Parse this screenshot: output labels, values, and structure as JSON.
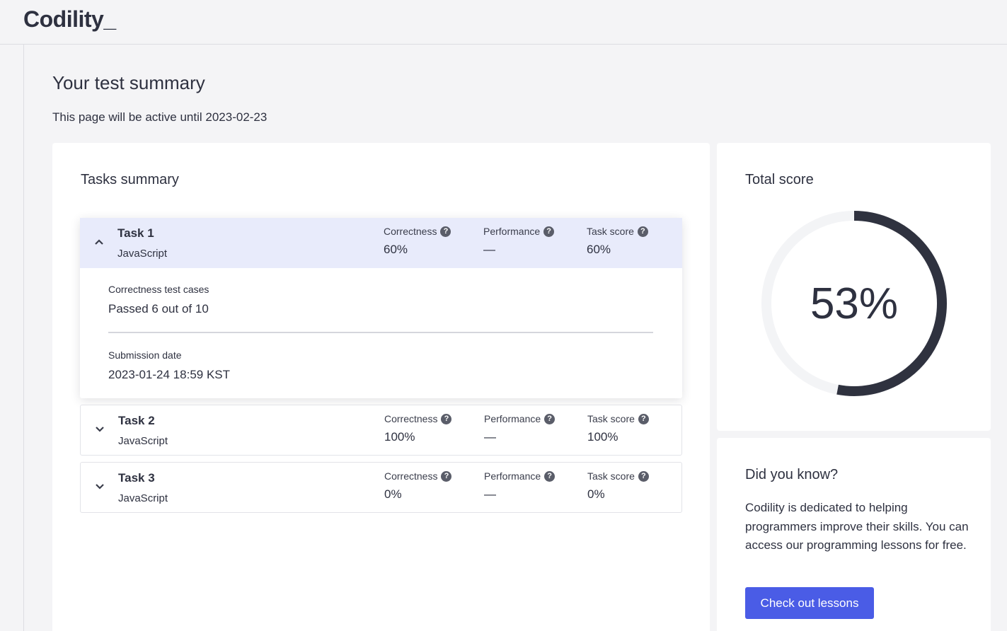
{
  "app": {
    "logo": "Codility_"
  },
  "page": {
    "title": "Your test summary",
    "active_until": "This page will be active until 2023-02-23"
  },
  "tasks_summary": {
    "title": "Tasks summary",
    "metric_labels": {
      "correctness": "Correctness",
      "performance": "Performance",
      "task_score": "Task score"
    },
    "help_glyph": "?",
    "tasks": [
      {
        "name": "Task 1",
        "language": "JavaScript",
        "correctness": "60%",
        "performance": "—",
        "task_score": "60%",
        "expanded": true,
        "details": {
          "test_cases_label": "Correctness test cases",
          "test_cases_value": "Passed 6 out of 10",
          "submission_label": "Submission date",
          "submission_value": "2023-01-24 18:59 KST"
        }
      },
      {
        "name": "Task 2",
        "language": "JavaScript",
        "correctness": "100%",
        "performance": "—",
        "task_score": "100%",
        "expanded": false
      },
      {
        "name": "Task 3",
        "language": "JavaScript",
        "correctness": "0%",
        "performance": "—",
        "task_score": "0%",
        "expanded": false
      }
    ]
  },
  "total_score": {
    "title": "Total score",
    "value_text": "53%",
    "fraction": 0.53
  },
  "did_you_know": {
    "title": "Did you know?",
    "text": "Codility is dedicated to helping programmers improve their skills. You can access our programming lessons for free.",
    "button_label": "Check out lessons"
  },
  "colors": {
    "accent": "#4a5ce6",
    "ring": "#2f323f",
    "ring_track": "#f3f4f6",
    "expanded_header": "#e8ebfb"
  },
  "icons": {
    "expanded": "chevron-up-icon",
    "collapsed": "chevron-down-icon",
    "help": "question-circle-icon"
  }
}
